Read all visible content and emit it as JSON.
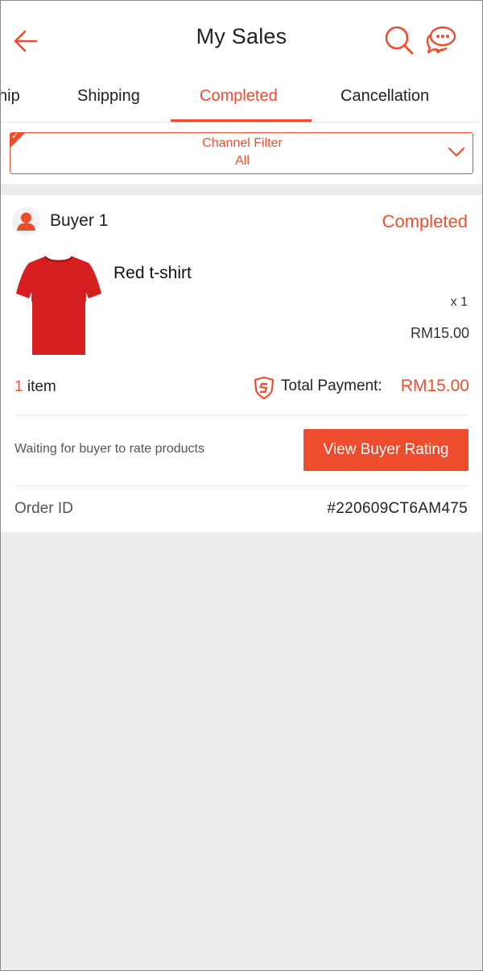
{
  "header": {
    "title": "My Sales",
    "back_icon": "arrow-left-icon",
    "search_icon": "search-icon",
    "chat_icon": "chat-icon"
  },
  "tabs": [
    {
      "label": "hip",
      "active": false
    },
    {
      "label": "Shipping",
      "active": false
    },
    {
      "label": "Completed",
      "active": true
    },
    {
      "label": "Cancellation",
      "active": false
    }
  ],
  "filter": {
    "label": "Channel Filter",
    "value": "All"
  },
  "order": {
    "buyer": "Buyer 1",
    "status": "Completed",
    "product_name": "Red t-shirt",
    "quantity": "x 1",
    "price": "RM15.00",
    "item_count_num": "1",
    "item_count_word": "item",
    "total_label": "Total Payment:",
    "total_value": "RM15.00",
    "waiting_text": "Waiting for buyer to rate products",
    "rate_button": "View Buyer Rating",
    "order_id_label": "Order ID",
    "order_id": "#220609CT6AM475"
  },
  "colors": {
    "accent": "#ee4d2d",
    "background": "#ededed",
    "product": "#d81f1f"
  }
}
